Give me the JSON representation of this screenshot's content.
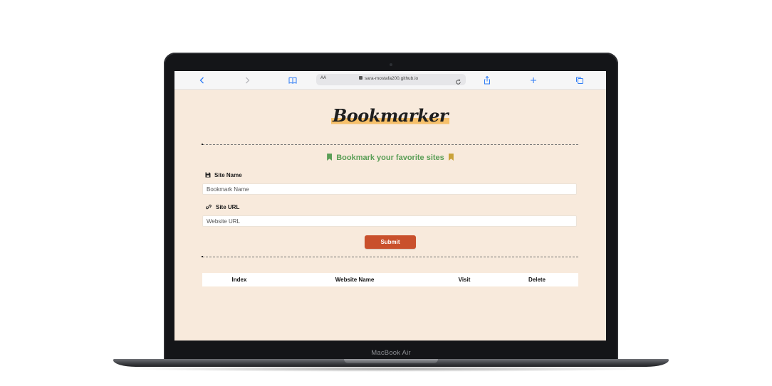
{
  "device": {
    "label": "MacBook Air"
  },
  "browser": {
    "reader_label": "AA",
    "url": "sara-mostafa200.github.io"
  },
  "page": {
    "logo": "Bookmarker",
    "subtitle": "Bookmark your favorite sites",
    "site_name_label": "Site Name",
    "site_name_placeholder": "Bookmark Name",
    "site_url_label": "Site URL",
    "site_url_placeholder": "Website URL",
    "submit_label": "Submit",
    "table_headers": [
      "Index",
      "Website Name",
      "Visit",
      "Delete"
    ]
  },
  "colors": {
    "page_background": "#f8eadc",
    "accent_green": "#5a9e56",
    "bookmark_gold": "#c9a23a",
    "submit_button": "#c9502c",
    "logo_highlight": "#f6c06a"
  }
}
